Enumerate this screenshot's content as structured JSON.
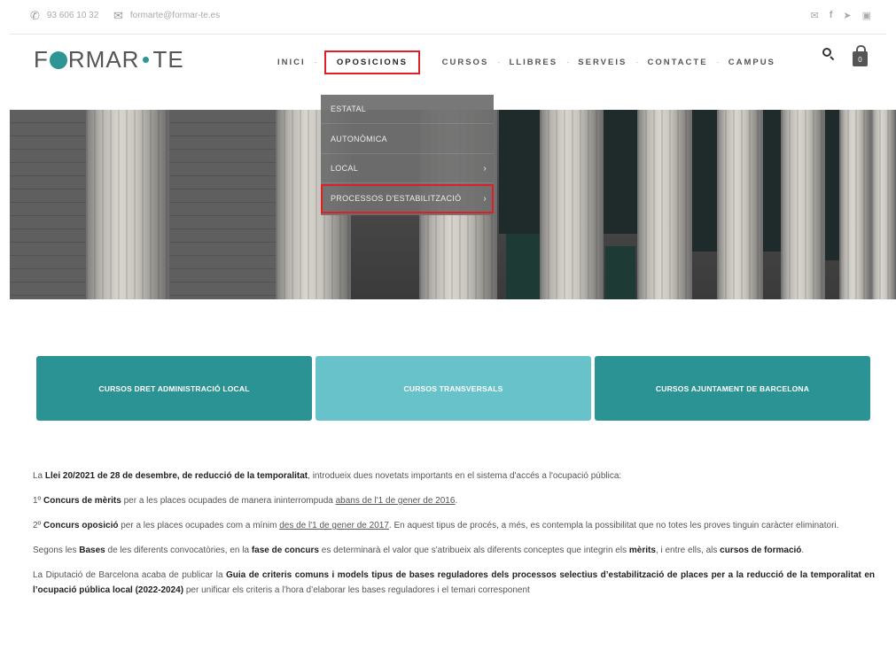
{
  "topbar": {
    "phone": "93 606 10 32",
    "email": "formarte@formar-te.es",
    "social": [
      "email-icon",
      "facebook-icon",
      "twitter-icon",
      "instagram-icon"
    ]
  },
  "header": {
    "logo_parts": [
      "F",
      "RMAR",
      "TE"
    ],
    "nav": [
      {
        "label": "INICI",
        "active": false
      },
      {
        "label": "OPOSICIONS",
        "active": true
      },
      {
        "label": "CURSOS",
        "active": false
      },
      {
        "label": "LLIBRES",
        "active": false
      },
      {
        "label": "SERVEIS",
        "active": false
      },
      {
        "label": "CONTACTE",
        "active": false
      },
      {
        "label": "CAMPUS",
        "active": false
      }
    ],
    "cart_count": "0"
  },
  "dropdown": {
    "items": [
      {
        "label": "ESTATAL",
        "has_submenu": false
      },
      {
        "label": "AUTONÒMICA",
        "has_submenu": false
      },
      {
        "label": "LOCAL",
        "has_submenu": true
      },
      {
        "label": "PROCESSOS D'ESTABILITZACIÓ",
        "has_submenu": true
      }
    ]
  },
  "cards": [
    {
      "label": "CURSOS DRET ADMINISTRACIÓ LOCAL"
    },
    {
      "label": "CURSOS TRANSVERSALS"
    },
    {
      "label": "CURSOS AJUNTAMENT DE BARCELONA"
    }
  ],
  "content": {
    "p1_a": "La ",
    "p1_b": "Llei 20/2021 de 28 de desembre, de reducció de la temporalitat",
    "p1_c": ", introdueix dues novetats importants en el sistema d'accés a l'ocupació pública:",
    "p2_a": "1º ",
    "p2_b": "Concurs de mèrits",
    "p2_c": " per a les places ocupades de manera ininterrompuda ",
    "p2_d": "abans de l'1 de gener de 2016",
    "p2_e": ".",
    "p3_a": "2º ",
    "p3_b": "Concurs oposició",
    "p3_c": " per a les places ocupades com a mínim ",
    "p3_d": "des de l'1 de gener de 2017",
    "p3_e": ". En aquest tipus de procés, a més, es contempla la possibilitat que no totes les proves tinguin caràcter eliminatori.",
    "p4_a": "Segons les ",
    "p4_b": "Bases",
    "p4_c": " de les diferents convocatòries, en la ",
    "p4_d": "fase de concurs",
    "p4_e": " es determinarà el valor que s'atribueix als diferents conceptes que integrin els ",
    "p4_f": "mèrits",
    "p4_g": ", i entre ells, als ",
    "p4_h": "cursos de formació",
    "p4_i": ".",
    "p5_a": "La Diputació de Barcelona acaba de publicar la ",
    "p5_b": "Guia de criteris comuns i models tipus de bases reguladores dels processos selectius d’estabilització de places per a la reducció de la  temporalitat en l’ocupació pública local (2022-2024)",
    "p5_c": "  per unificar els criteris a l’hora d’elaborar les bases reguladores i el temari corresponent"
  }
}
